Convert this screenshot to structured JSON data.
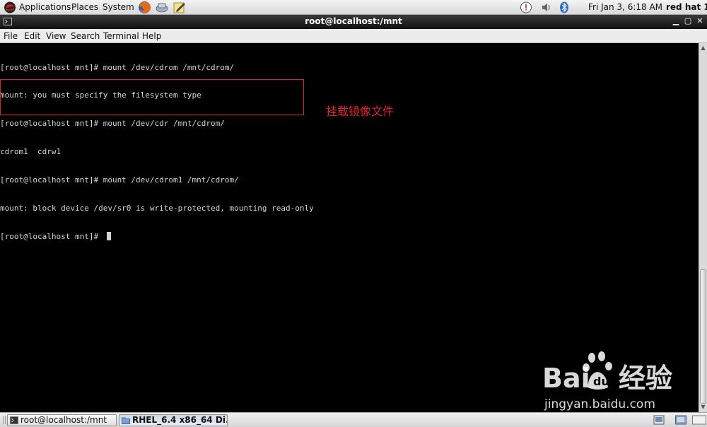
{
  "top_panel": {
    "menus": [
      "Applications",
      "Places",
      "System"
    ],
    "clock": "Fri Jan  3,  6:18 AM",
    "user": "red hat 1"
  },
  "window": {
    "title": "root@localhost:/mnt"
  },
  "menubar": {
    "items": [
      "File",
      "Edit",
      "View",
      "Search",
      "Terminal",
      "Help"
    ]
  },
  "terminal": {
    "lines": [
      "[root@localhost mnt]# mount /dev/cdrom /mnt/cdrom/",
      "mount: you must specify the filesystem type",
      "[root@localhost mnt]# mount /dev/cdr /mnt/cdrom/",
      "cdrom1  cdrw1",
      "[root@localhost mnt]# mount /dev/cdrom1 /mnt/cdrom/",
      "mount: block device /dev/sr0 is write-protected, mounting read-only",
      "[root@localhost mnt]# "
    ],
    "annotation": "挂载镜像文件",
    "foreground": "#d3d7cf",
    "highlight_color": "#d8252b"
  },
  "watermark": {
    "brand": "Bai du 经验",
    "url": "jingyan.baidu.com"
  },
  "taskbar": {
    "tasks": [
      "root@localhost:/mnt",
      "RHEL_6.4 x86_64 Di..."
    ]
  }
}
